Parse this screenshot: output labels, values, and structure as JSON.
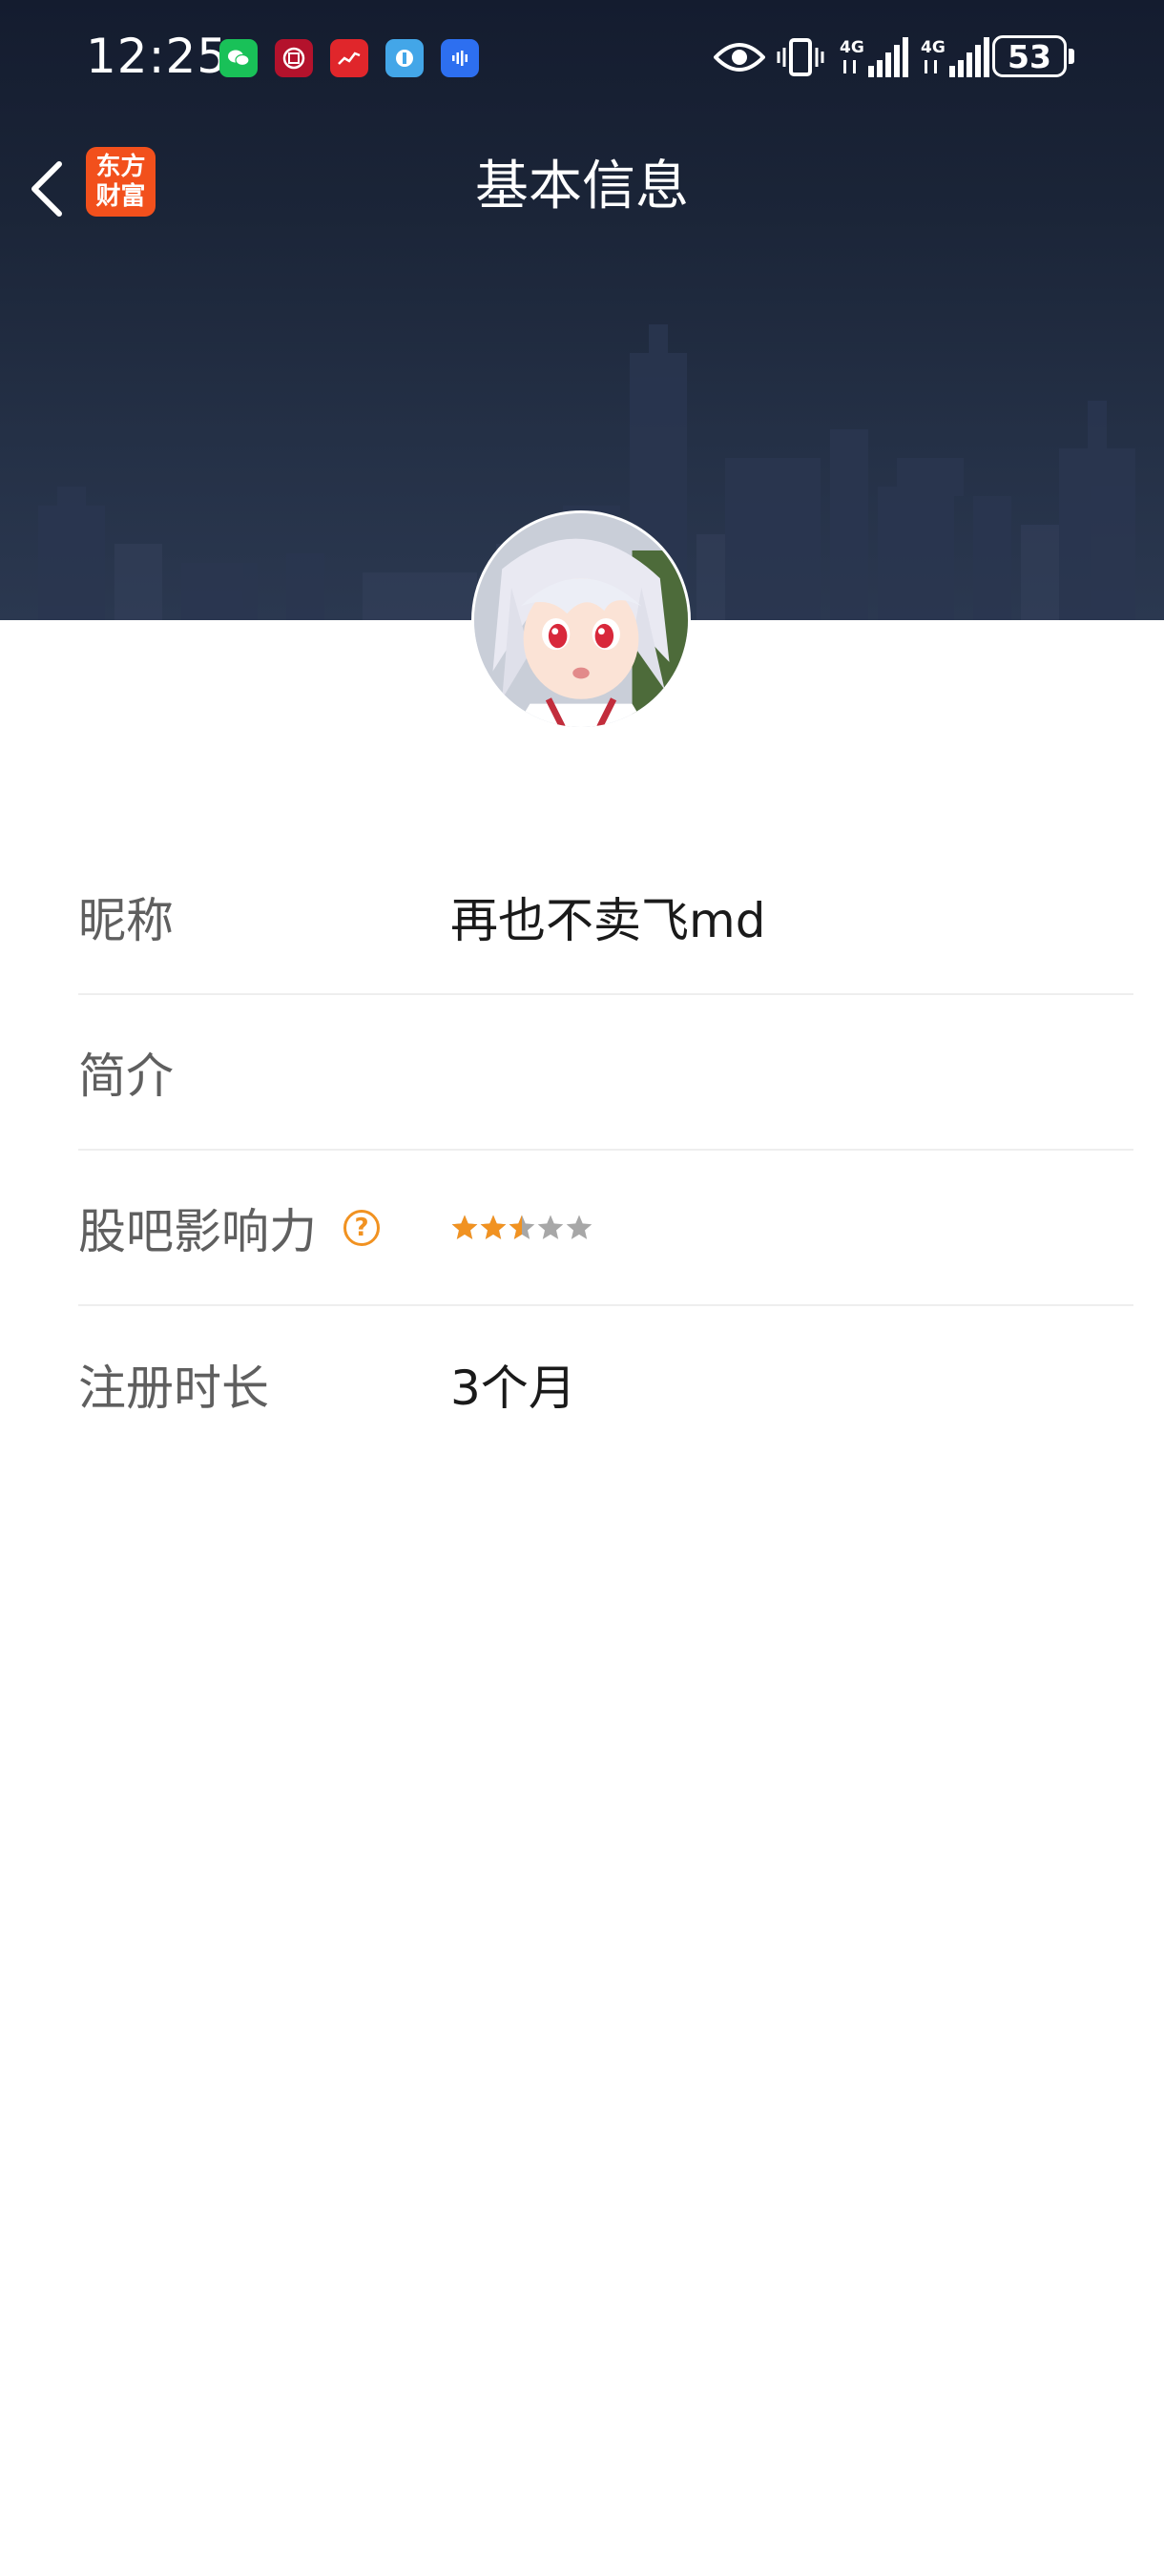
{
  "status_bar": {
    "time": "12:25",
    "battery": "53",
    "network_1": "4G",
    "network_2": "4G",
    "notification_icons": [
      "wechat-icon",
      "bank-icon",
      "stock-app-icon",
      "app-icon-blue",
      "voice-app-icon"
    ],
    "right_icons": [
      "eye-icon",
      "vibrate-icon",
      "signal-icon",
      "signal-icon"
    ]
  },
  "header": {
    "title": "基本信息",
    "logo_line1": "东方",
    "logo_line2": "财富",
    "back_icon": "chevron-left-icon"
  },
  "profile": {
    "avatar": "user-avatar-anime",
    "rows": [
      {
        "label": "昵称",
        "value": "再也不卖飞md"
      },
      {
        "label": "简介",
        "value": ""
      },
      {
        "label": "股吧影响力",
        "help_icon": "question-circle-icon",
        "help_glyph": "?",
        "rating": 2.5,
        "rating_max": 5
      },
      {
        "label": "注册时长",
        "value": "3个月"
      }
    ]
  },
  "colors": {
    "header_bg": "#1b2538",
    "logo_bg": "#f2501c",
    "accent_orange": "#f19221",
    "star_gray": "#a7a7a7",
    "label_gray": "#5f5f5f",
    "divider": "#eeeeee"
  }
}
